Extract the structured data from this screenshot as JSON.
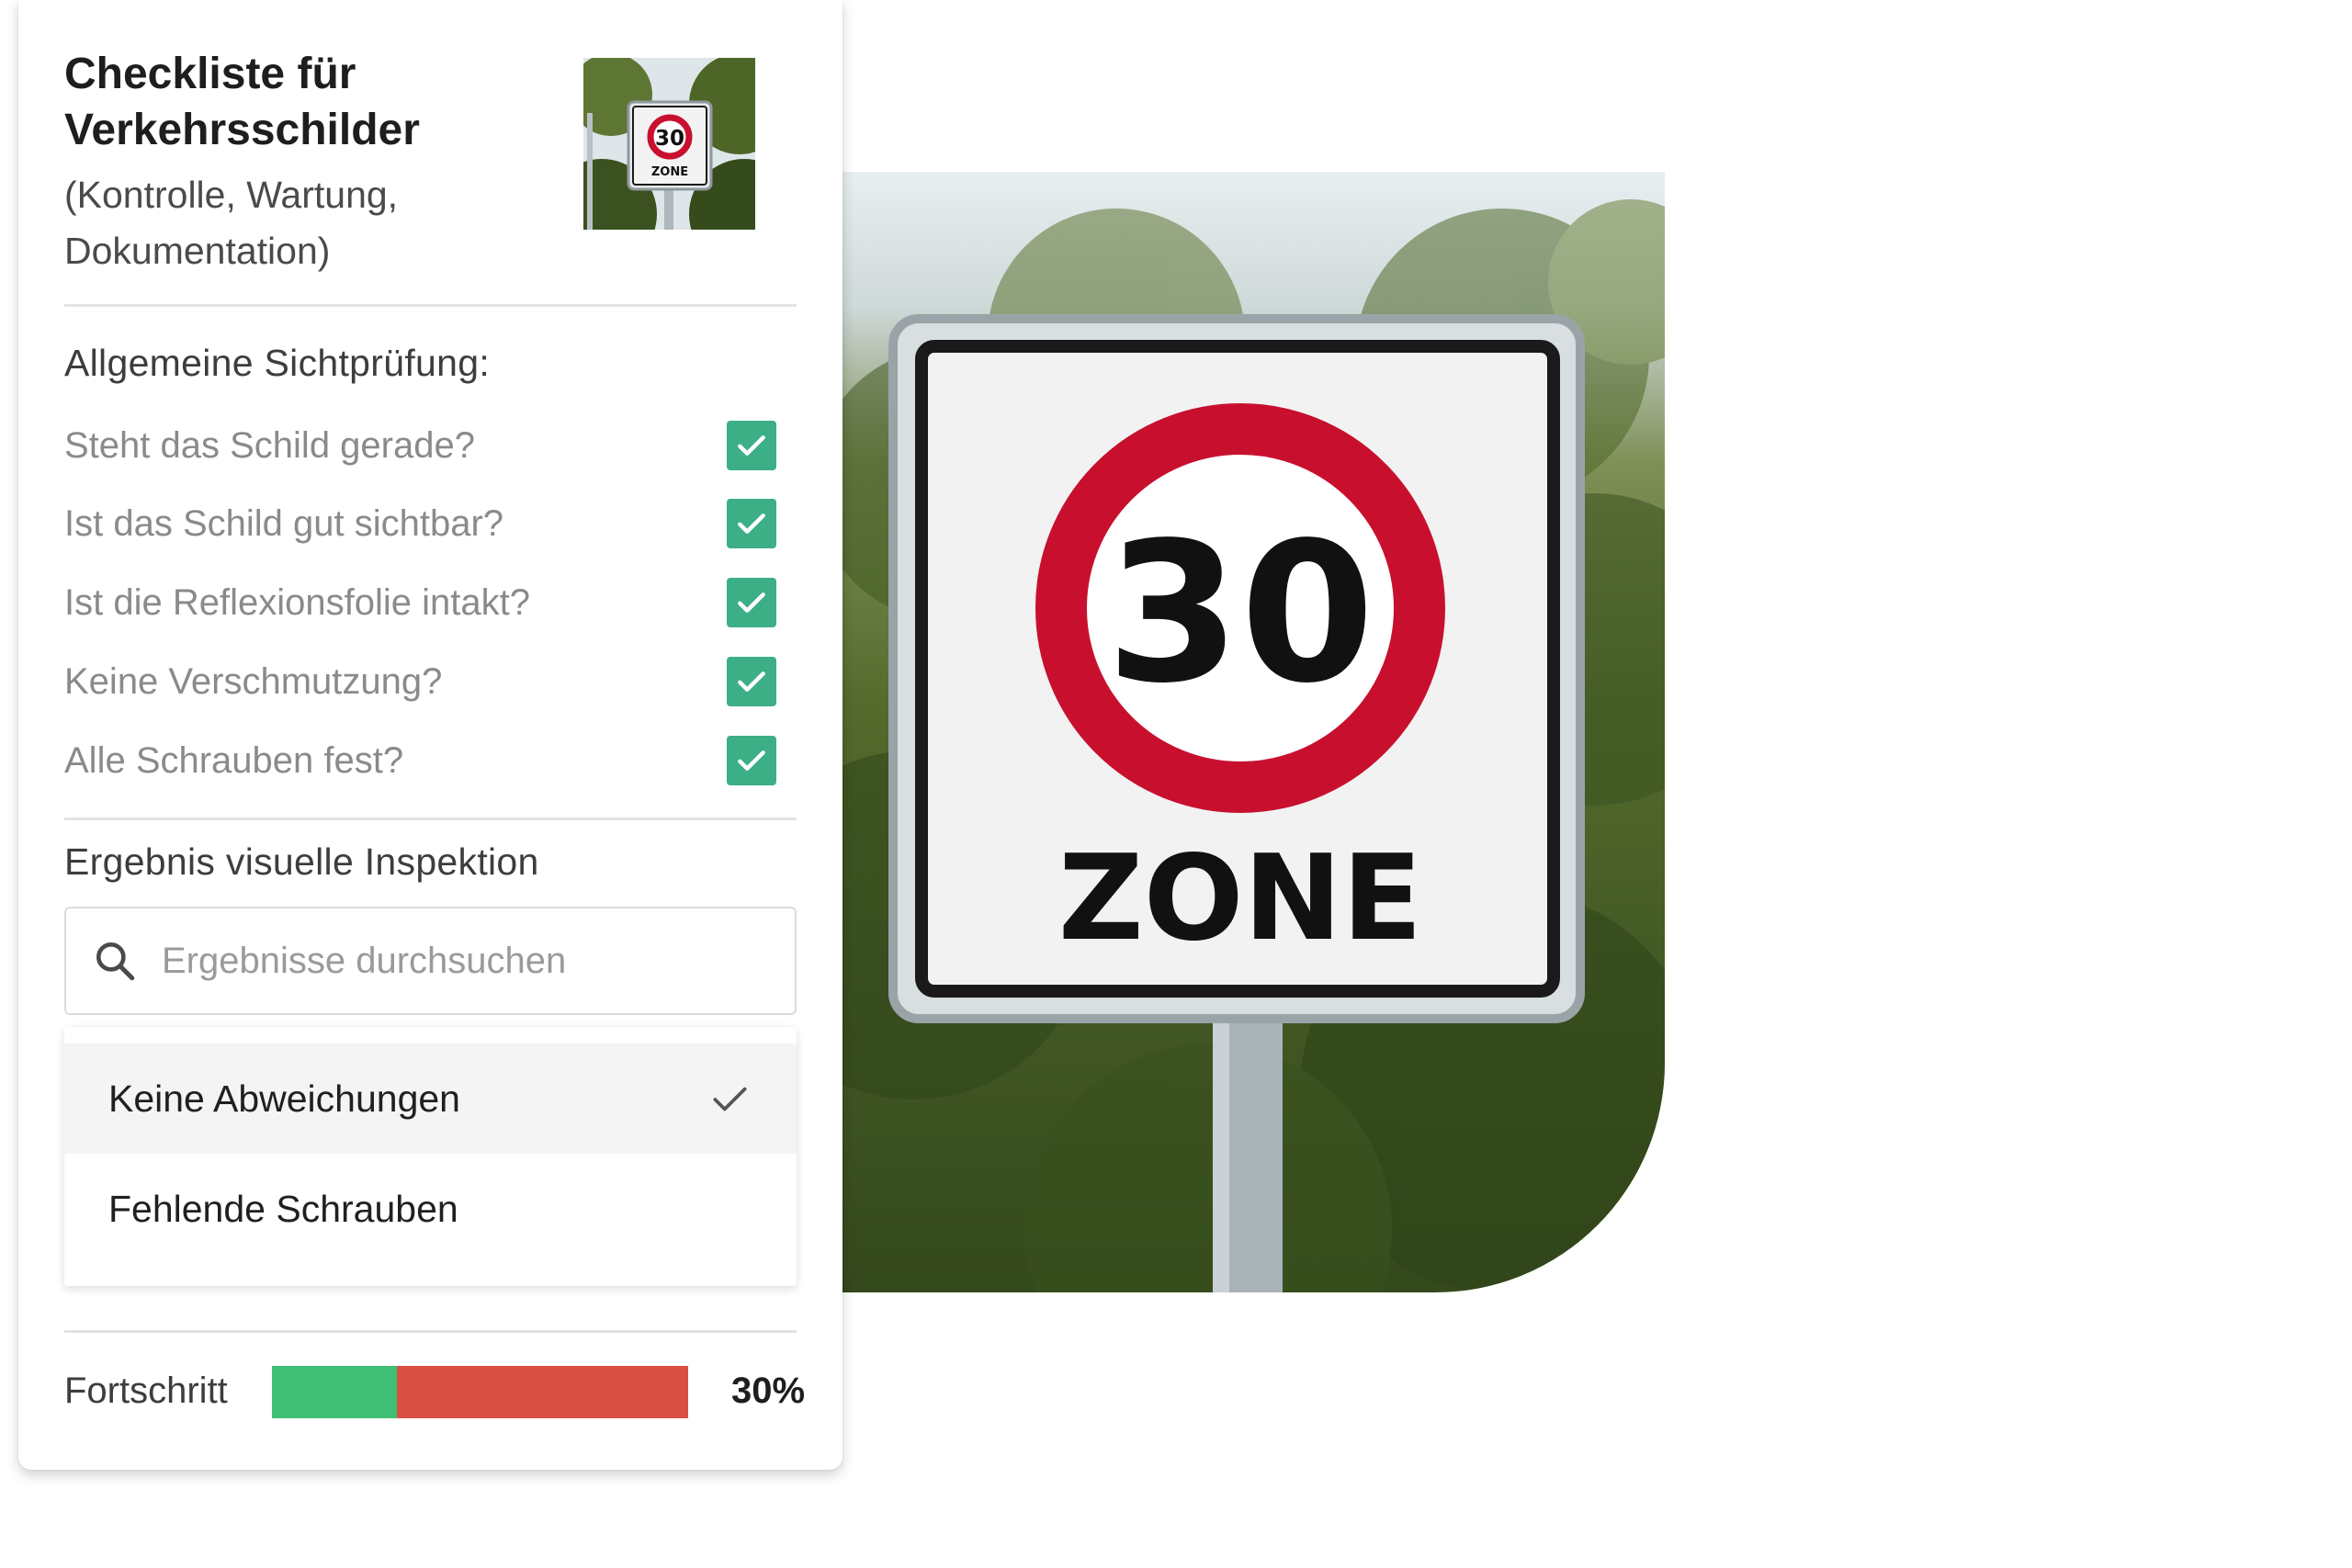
{
  "header": {
    "title": "Checkliste für Verkehrsschilder",
    "subtitle": "(Kontrolle, Wartung, Dokumentation)"
  },
  "sign": {
    "number": "30",
    "word": "ZONE"
  },
  "visual_check": {
    "heading": "Allgemeine Sichtprüfung:",
    "items": [
      {
        "label": "Steht das Schild gerade?",
        "checked": true
      },
      {
        "label": "Ist das Schild gut sichtbar?",
        "checked": true
      },
      {
        "label": "Ist die Reflexionsfolie intakt?",
        "checked": true
      },
      {
        "label": "Keine Verschmutzung?",
        "checked": true
      },
      {
        "label": "Alle Schrauben fest?",
        "checked": true
      }
    ]
  },
  "result": {
    "heading": "Ergebnis visuelle Inspektion",
    "search_placeholder": "Ergebnisse durchsuchen",
    "options": [
      {
        "label": "Keine Abweichungen",
        "selected": true
      },
      {
        "label": "Fehlende Schrauben",
        "selected": false
      }
    ]
  },
  "progress": {
    "label": "Fortschritt",
    "value": 30,
    "value_text": "30%",
    "fill_color": "#3fbf74",
    "track_color": "#d94f44"
  },
  "colors": {
    "checkbox": "#3caf86",
    "sign_red": "#c8102e"
  },
  "icons": [
    "checkmark-icon",
    "search-icon",
    "check-icon"
  ]
}
